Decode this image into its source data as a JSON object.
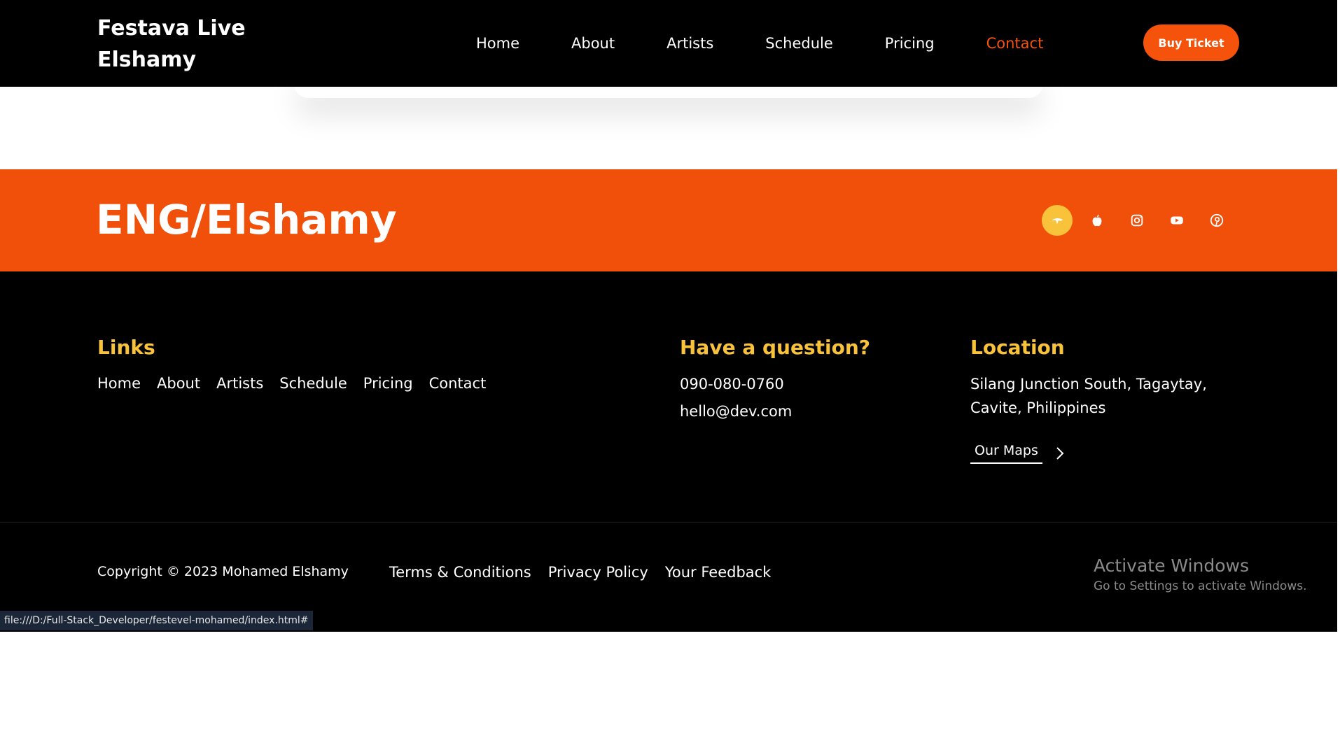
{
  "navbar": {
    "brand_line1": "Festava Live",
    "brand_line2": "Elshamy",
    "links": [
      "Home",
      "About",
      "Artists",
      "Schedule",
      "Pricing",
      "Contact"
    ],
    "active_link": "Contact",
    "buy_ticket_label": "Buy Ticket"
  },
  "banner": {
    "title": "ENG/Elshamy",
    "social_icons": [
      "app-store-icon",
      "apple-icon",
      "instagram-icon",
      "youtube-icon",
      "pinterest-icon"
    ]
  },
  "footer": {
    "links_heading": "Links",
    "links": [
      "Home",
      "About",
      "Artists",
      "Schedule",
      "Pricing",
      "Contact"
    ],
    "question_heading": "Have a question?",
    "phone": "090-080-0760",
    "email": "hello@dev.com",
    "location_heading": "Location",
    "address_line1": "Silang Junction South, Tagaytay,",
    "address_line2": "Cavite, Philippines",
    "maps_label": "Our Maps",
    "copyright": "Copyright © 2023 Mohamed Elshamy",
    "legal_links": [
      "Terms & Conditions",
      "Privacy Policy",
      "Your Feedback"
    ]
  },
  "os_overlay": {
    "activate_title": "Activate Windows",
    "activate_sub": "Go to Settings to activate Windows."
  },
  "status_bar": {
    "url": "file:///D:/Full-Stack_Developer/festevel-mohamed/index.html#"
  },
  "colors": {
    "accent_orange": "#f0500a",
    "accent_yellow": "#f8c23a",
    "background_dark": "#000000"
  }
}
